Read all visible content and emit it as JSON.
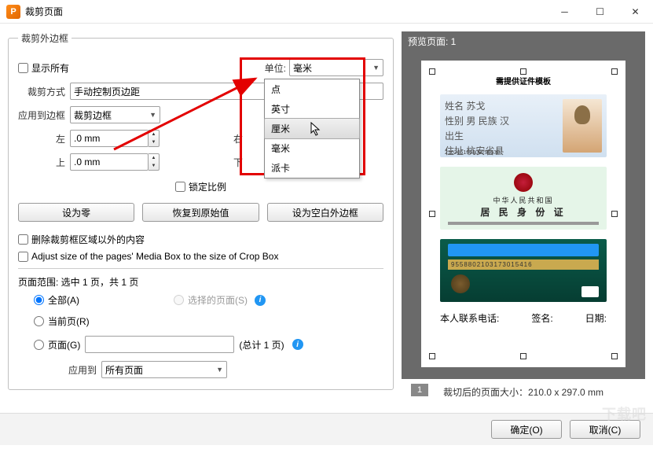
{
  "window": {
    "title": "裁剪页面"
  },
  "groupbox": {
    "title": "裁剪外边框"
  },
  "show_all": {
    "label": "显示所有"
  },
  "unit": {
    "label": "单位:",
    "value": "毫米",
    "options": [
      "点",
      "英寸",
      "厘米",
      "毫米",
      "派卡"
    ]
  },
  "crop_method": {
    "label": "裁剪方式",
    "value": "手动控制页边距"
  },
  "apply_border": {
    "label": "应用到边框",
    "value": "裁剪边框"
  },
  "left": {
    "label": "左",
    "value": ".0 mm"
  },
  "right": {
    "label": "右",
    "value": ""
  },
  "top": {
    "label": "上",
    "value": ".0 mm"
  },
  "bottom": {
    "label": "下",
    "value": ""
  },
  "lock_ratio": {
    "label": "锁定比例"
  },
  "buttons": {
    "zero": "设为零",
    "restore": "恢复到原始值",
    "blank": "设为空白外边框"
  },
  "checks": {
    "remove_outside": "删除裁剪框区域以外的内容",
    "adjust_media": "Adjust size of the pages' Media Box to the size of Crop Box"
  },
  "range": {
    "title": "页面范围: 选中 1 页，共 1 页",
    "all": "全部(A)",
    "selected": "选择的页面(S)",
    "current": "当前页(R)",
    "pages": "页面(G)",
    "total": "(总计 1 页)"
  },
  "apply_to": {
    "label": "应用到",
    "value": "所有页面"
  },
  "preview": {
    "header": "预览页面: 1",
    "page_num": "1",
    "doc_title": "需提供证件模板",
    "card1_num": "210205196808296530",
    "card2_line1": "中华人民共和国",
    "card2_line2": "居 民 身 份 证",
    "card3_num": "9558802103173015416",
    "foot1": "本人联系电话:",
    "foot2": "签名:",
    "foot3": "日期:"
  },
  "footer": {
    "size": "裁切后的页面大小：210.0 x 297.0  mm"
  },
  "dialog": {
    "ok": "确定(O)",
    "cancel": "取消(C)"
  },
  "card1_fields": [
    "姓名  苏戈",
    "性别  男    民族  汉",
    "出生",
    "住址  杭安省县"
  ]
}
